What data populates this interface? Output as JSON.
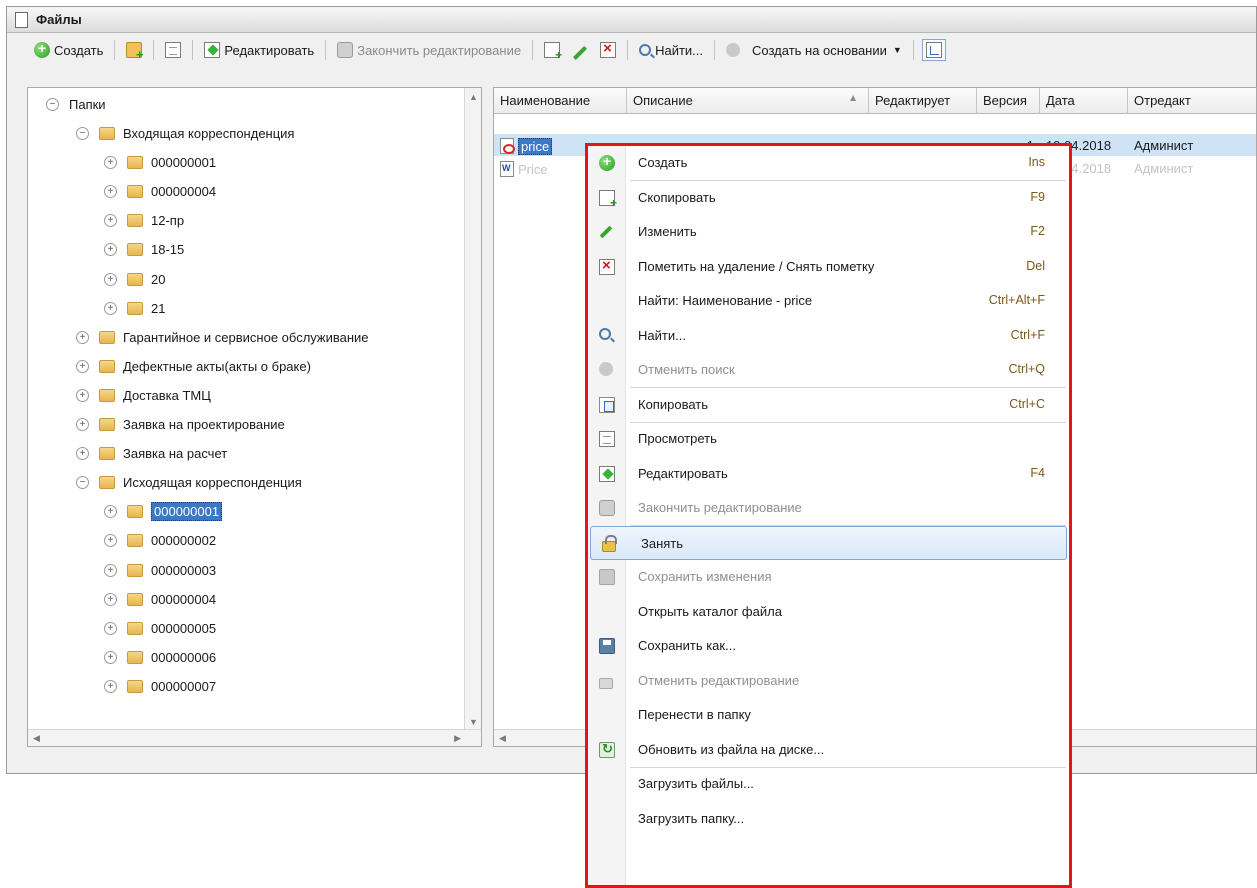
{
  "window": {
    "title": "Файлы"
  },
  "toolbar": {
    "create": "Создать",
    "edit": "Редактировать",
    "finish_edit": "Закончить редактирование",
    "find": "Найти...",
    "create_based_on": "Создать на основании"
  },
  "tree": {
    "root": "Папки",
    "items": [
      {
        "label": "Входящая корреспонденция",
        "level": 1,
        "expanded": true
      },
      {
        "label": "000000001",
        "level": 2,
        "expanded": false
      },
      {
        "label": "000000004",
        "level": 2,
        "expanded": false
      },
      {
        "label": "12-пр",
        "level": 2,
        "expanded": false
      },
      {
        "label": "18-15",
        "level": 2,
        "expanded": false
      },
      {
        "label": "20",
        "level": 2,
        "expanded": false
      },
      {
        "label": "21",
        "level": 2,
        "expanded": false
      },
      {
        "label": "Гарантийное и сервисное обслуживание",
        "level": 1,
        "expanded": false
      },
      {
        "label": "Дефектные акты(акты о браке)",
        "level": 1,
        "expanded": false
      },
      {
        "label": "Доставка ТМЦ",
        "level": 1,
        "expanded": false
      },
      {
        "label": "Заявка на проектирование",
        "level": 1,
        "expanded": false
      },
      {
        "label": "Заявка на расчет",
        "level": 1,
        "expanded": false
      },
      {
        "label": "Исходящая корреспонденция",
        "level": 1,
        "expanded": true
      },
      {
        "label": "000000001",
        "level": 2,
        "expanded": false,
        "selected": true
      },
      {
        "label": "000000002",
        "level": 2,
        "expanded": false
      },
      {
        "label": "000000003",
        "level": 2,
        "expanded": false
      },
      {
        "label": "000000004",
        "level": 2,
        "expanded": false
      },
      {
        "label": "000000005",
        "level": 2,
        "expanded": false
      },
      {
        "label": "000000006",
        "level": 2,
        "expanded": false
      },
      {
        "label": "000000007",
        "level": 2,
        "expanded": false
      }
    ]
  },
  "table": {
    "columns": [
      "Наименование",
      "Описание",
      "Редактирует",
      "Версия",
      "Дата",
      "Отредакт"
    ],
    "rows": [
      {
        "name": "price",
        "description": "",
        "editor": "",
        "version": "1",
        "date": "19.04.2018",
        "edited_by": "Админист",
        "selected": true,
        "icon": "pdf-file-icon"
      },
      {
        "name": "Price",
        "description": "",
        "editor": "",
        "version": "",
        "date": "19.04.2018",
        "edited_by": "Админист",
        "selected": false,
        "icon": "word-file-icon"
      }
    ]
  },
  "context_menu": {
    "items": [
      {
        "id": "create",
        "label": "Создать",
        "shortcut": "Ins",
        "icon": "create-icon"
      },
      {
        "id": "copy-item",
        "label": "Скопировать",
        "shortcut": "F9",
        "icon": "copy-add-icon"
      },
      {
        "id": "change",
        "label": "Изменить",
        "shortcut": "F2",
        "icon": "pencil-icon"
      },
      {
        "id": "mark-delete",
        "label": "Пометить на удаление / Снять пометку",
        "shortcut": "Del",
        "icon": "delete-icon"
      },
      {
        "id": "find-by-name",
        "label": "Найти: Наименование - price",
        "shortcut": "Ctrl+Alt+F",
        "icon": ""
      },
      {
        "id": "find",
        "label": "Найти...",
        "shortcut": "Ctrl+F",
        "icon": "search-icon"
      },
      {
        "id": "cancel-find",
        "label": "Отменить поиск",
        "shortcut": "Ctrl+Q",
        "icon": "cancel-search-icon",
        "disabled": true
      },
      {
        "id": "copy",
        "label": "Копировать",
        "shortcut": "Ctrl+C",
        "icon": "copy-icon"
      },
      {
        "id": "view",
        "label": "Просмотреть",
        "shortcut": "",
        "icon": "view-icon"
      },
      {
        "id": "edit",
        "label": "Редактировать",
        "shortcut": "F4",
        "icon": "edit-icon"
      },
      {
        "id": "finish-edit",
        "label": "Закончить редактирование",
        "shortcut": "",
        "icon": "finish-edit-icon",
        "disabled": true
      },
      {
        "id": "lock",
        "label": "Занять",
        "shortcut": "",
        "icon": "lock-icon",
        "highlight": true
      },
      {
        "id": "save-changes",
        "label": "Сохранить изменения",
        "shortcut": "",
        "icon": "save-changes-icon",
        "disabled": true
      },
      {
        "id": "open-folder",
        "label": "Открыть каталог файла",
        "shortcut": "",
        "icon": ""
      },
      {
        "id": "save-as",
        "label": "Сохранить как...",
        "shortcut": "",
        "icon": "save-icon"
      },
      {
        "id": "cancel-edit",
        "label": "Отменить редактирование",
        "shortcut": "",
        "icon": "unlock-icon",
        "disabled": true
      },
      {
        "id": "move-to-folder",
        "label": "Перенести в папку",
        "shortcut": "",
        "icon": ""
      },
      {
        "id": "update-from-disk",
        "label": "Обновить из файла на диске...",
        "shortcut": "",
        "icon": "refresh-icon"
      },
      {
        "id": "upload-files",
        "label": "Загрузить файлы...",
        "shortcut": "",
        "icon": ""
      },
      {
        "id": "upload-folder",
        "label": "Загрузить папку...",
        "shortcut": "",
        "icon": ""
      }
    ]
  },
  "colors": {
    "selection": "#3b78c6",
    "row_selected": "#cfe3f7",
    "highlight_border": "#e3141b"
  }
}
